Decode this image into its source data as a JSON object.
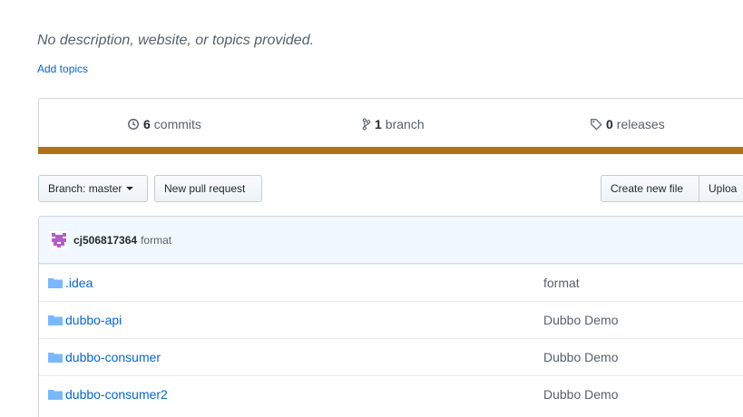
{
  "repo": {
    "description": "No description, website, or topics provided.",
    "add_topics": "Add topics"
  },
  "summary": {
    "commits_count": "6",
    "commits_label": "commits",
    "branch_count": "1",
    "branch_label": "branch",
    "releases_count": "0",
    "releases_label": "releases",
    "language_color": "#b07219"
  },
  "toolbar": {
    "branch_label": "Branch: master",
    "new_pull_request": "New pull request",
    "create_new_file": "Create new file",
    "upload": "Uploa"
  },
  "latest_commit": {
    "author": "cj506817364",
    "message": "format"
  },
  "files": [
    {
      "name": ".idea",
      "commit_message": "format"
    },
    {
      "name": "dubbo-api",
      "commit_message": "Dubbo Demo"
    },
    {
      "name": "dubbo-consumer",
      "commit_message": "Dubbo Demo"
    },
    {
      "name": "dubbo-consumer2",
      "commit_message": "Dubbo Demo"
    }
  ]
}
